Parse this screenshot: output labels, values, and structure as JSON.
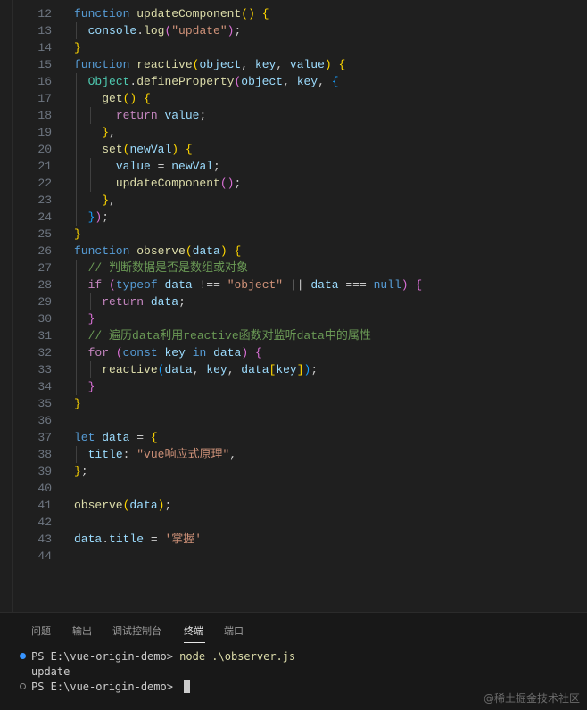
{
  "editor": {
    "lines": [
      {
        "num": "12",
        "tokens": [
          {
            "t": "function",
            "c": "k"
          },
          {
            "t": " "
          },
          {
            "t": "updateComponent",
            "c": "f"
          },
          {
            "t": "()",
            "c": "b1"
          },
          {
            "t": " "
          },
          {
            "t": "{",
            "c": "b1"
          }
        ]
      },
      {
        "num": "13",
        "tokens": [
          {
            "t": "  "
          },
          {
            "t": "console",
            "c": "v"
          },
          {
            "t": "."
          },
          {
            "t": "log",
            "c": "f"
          },
          {
            "t": "(",
            "c": "b2"
          },
          {
            "t": "\"update\"",
            "c": "s"
          },
          {
            "t": ")",
            "c": "b2"
          },
          {
            "t": ";"
          }
        ]
      },
      {
        "num": "14",
        "tokens": [
          {
            "t": "}",
            "c": "b1"
          }
        ]
      },
      {
        "num": "15",
        "tokens": [
          {
            "t": "function",
            "c": "k"
          },
          {
            "t": " "
          },
          {
            "t": "reactive",
            "c": "f"
          },
          {
            "t": "(",
            "c": "b1"
          },
          {
            "t": "object",
            "c": "v"
          },
          {
            "t": ", "
          },
          {
            "t": "key",
            "c": "v"
          },
          {
            "t": ", "
          },
          {
            "t": "value",
            "c": "v"
          },
          {
            "t": ")",
            "c": "b1"
          },
          {
            "t": " "
          },
          {
            "t": "{",
            "c": "b1"
          }
        ]
      },
      {
        "num": "16",
        "tokens": [
          {
            "t": "  "
          },
          {
            "t": "Object",
            "c": "t"
          },
          {
            "t": "."
          },
          {
            "t": "defineProperty",
            "c": "f"
          },
          {
            "t": "(",
            "c": "b2"
          },
          {
            "t": "object",
            "c": "v"
          },
          {
            "t": ", "
          },
          {
            "t": "key",
            "c": "v"
          },
          {
            "t": ", "
          },
          {
            "t": "{",
            "c": "b3"
          }
        ]
      },
      {
        "num": "17",
        "tokens": [
          {
            "t": "    "
          },
          {
            "t": "get",
            "c": "f"
          },
          {
            "t": "()",
            "c": "b1"
          },
          {
            "t": " "
          },
          {
            "t": "{",
            "c": "b1"
          }
        ]
      },
      {
        "num": "18",
        "tokens": [
          {
            "t": "      "
          },
          {
            "t": "return",
            "c": "c"
          },
          {
            "t": " "
          },
          {
            "t": "value",
            "c": "v"
          },
          {
            "t": ";"
          }
        ]
      },
      {
        "num": "19",
        "tokens": [
          {
            "t": "    "
          },
          {
            "t": "}",
            "c": "b1"
          },
          {
            "t": ","
          }
        ]
      },
      {
        "num": "20",
        "tokens": [
          {
            "t": "    "
          },
          {
            "t": "set",
            "c": "f"
          },
          {
            "t": "(",
            "c": "b1"
          },
          {
            "t": "newVal",
            "c": "v"
          },
          {
            "t": ")",
            "c": "b1"
          },
          {
            "t": " "
          },
          {
            "t": "{",
            "c": "b1"
          }
        ]
      },
      {
        "num": "21",
        "tokens": [
          {
            "t": "      "
          },
          {
            "t": "value",
            "c": "v"
          },
          {
            "t": " = "
          },
          {
            "t": "newVal",
            "c": "v"
          },
          {
            "t": ";"
          }
        ]
      },
      {
        "num": "22",
        "tokens": [
          {
            "t": "      "
          },
          {
            "t": "updateComponent",
            "c": "f"
          },
          {
            "t": "()",
            "c": "b2"
          },
          {
            "t": ";"
          }
        ]
      },
      {
        "num": "23",
        "tokens": [
          {
            "t": "    "
          },
          {
            "t": "}",
            "c": "b1"
          },
          {
            "t": ","
          }
        ]
      },
      {
        "num": "24",
        "tokens": [
          {
            "t": "  "
          },
          {
            "t": "}",
            "c": "b3"
          },
          {
            "t": ")",
            "c": "b2"
          },
          {
            "t": ";"
          }
        ]
      },
      {
        "num": "25",
        "tokens": [
          {
            "t": "}",
            "c": "b1"
          }
        ]
      },
      {
        "num": "26",
        "tokens": [
          {
            "t": "function",
            "c": "k"
          },
          {
            "t": " "
          },
          {
            "t": "observe",
            "c": "f"
          },
          {
            "t": "(",
            "c": "b1"
          },
          {
            "t": "data",
            "c": "v"
          },
          {
            "t": ")",
            "c": "b1"
          },
          {
            "t": " "
          },
          {
            "t": "{",
            "c": "b1"
          }
        ]
      },
      {
        "num": "27",
        "tokens": [
          {
            "t": "  "
          },
          {
            "t": "// 判断数据是否是数组或对象",
            "c": "cm"
          }
        ]
      },
      {
        "num": "28",
        "tokens": [
          {
            "t": "  "
          },
          {
            "t": "if",
            "c": "c"
          },
          {
            "t": " "
          },
          {
            "t": "(",
            "c": "b2"
          },
          {
            "t": "typeof",
            "c": "k"
          },
          {
            "t": " "
          },
          {
            "t": "data",
            "c": "v"
          },
          {
            "t": " !== "
          },
          {
            "t": "\"object\"",
            "c": "s"
          },
          {
            "t": " || "
          },
          {
            "t": "data",
            "c": "v"
          },
          {
            "t": " === "
          },
          {
            "t": "null",
            "c": "k"
          },
          {
            "t": ")",
            "c": "b2"
          },
          {
            "t": " "
          },
          {
            "t": "{",
            "c": "b2"
          }
        ]
      },
      {
        "num": "29",
        "tokens": [
          {
            "t": "    "
          },
          {
            "t": "return",
            "c": "c"
          },
          {
            "t": " "
          },
          {
            "t": "data",
            "c": "v"
          },
          {
            "t": ";"
          }
        ]
      },
      {
        "num": "30",
        "tokens": [
          {
            "t": "  "
          },
          {
            "t": "}",
            "c": "b2"
          }
        ]
      },
      {
        "num": "31",
        "tokens": [
          {
            "t": "  "
          },
          {
            "t": "// 遍历data利用reactive函数对监听data中的属性",
            "c": "cm"
          }
        ]
      },
      {
        "num": "32",
        "tokens": [
          {
            "t": "  "
          },
          {
            "t": "for",
            "c": "c"
          },
          {
            "t": " "
          },
          {
            "t": "(",
            "c": "b2"
          },
          {
            "t": "const",
            "c": "k"
          },
          {
            "t": " "
          },
          {
            "t": "key",
            "c": "v"
          },
          {
            "t": " "
          },
          {
            "t": "in",
            "c": "k"
          },
          {
            "t": " "
          },
          {
            "t": "data",
            "c": "v"
          },
          {
            "t": ")",
            "c": "b2"
          },
          {
            "t": " "
          },
          {
            "t": "{",
            "c": "b2"
          }
        ]
      },
      {
        "num": "33",
        "tokens": [
          {
            "t": "    "
          },
          {
            "t": "reactive",
            "c": "f"
          },
          {
            "t": "(",
            "c": "b3"
          },
          {
            "t": "data",
            "c": "v"
          },
          {
            "t": ", "
          },
          {
            "t": "key",
            "c": "v"
          },
          {
            "t": ", "
          },
          {
            "t": "data",
            "c": "v"
          },
          {
            "t": "[",
            "c": "b1"
          },
          {
            "t": "key",
            "c": "v"
          },
          {
            "t": "]",
            "c": "b1"
          },
          {
            "t": ")",
            "c": "b3"
          },
          {
            "t": ";"
          }
        ]
      },
      {
        "num": "34",
        "tokens": [
          {
            "t": "  "
          },
          {
            "t": "}",
            "c": "b2"
          }
        ]
      },
      {
        "num": "35",
        "tokens": [
          {
            "t": "}",
            "c": "b1"
          }
        ]
      },
      {
        "num": "36",
        "tokens": []
      },
      {
        "num": "37",
        "tokens": [
          {
            "t": "let",
            "c": "k"
          },
          {
            "t": " "
          },
          {
            "t": "data",
            "c": "v"
          },
          {
            "t": " = "
          },
          {
            "t": "{",
            "c": "b1"
          }
        ]
      },
      {
        "num": "38",
        "tokens": [
          {
            "t": "  "
          },
          {
            "t": "title",
            "c": "v"
          },
          {
            "t": ": "
          },
          {
            "t": "\"vue响应式原理\"",
            "c": "s"
          },
          {
            "t": ","
          }
        ]
      },
      {
        "num": "39",
        "tokens": [
          {
            "t": "}",
            "c": "b1"
          },
          {
            "t": ";"
          }
        ]
      },
      {
        "num": "40",
        "tokens": []
      },
      {
        "num": "41",
        "tokens": [
          {
            "t": "observe",
            "c": "f"
          },
          {
            "t": "(",
            "c": "b1"
          },
          {
            "t": "data",
            "c": "v"
          },
          {
            "t": ")",
            "c": "b1"
          },
          {
            "t": ";"
          }
        ]
      },
      {
        "num": "42",
        "tokens": []
      },
      {
        "num": "43",
        "tokens": [
          {
            "t": "data",
            "c": "v"
          },
          {
            "t": "."
          },
          {
            "t": "title",
            "c": "v"
          },
          {
            "t": " = "
          },
          {
            "t": "'掌握'",
            "c": "s"
          }
        ]
      },
      {
        "num": "44",
        "tokens": []
      }
    ]
  },
  "panel": {
    "tabs": [
      {
        "label": "问题",
        "active": false
      },
      {
        "label": "输出",
        "active": false
      },
      {
        "label": "调试控制台",
        "active": false
      },
      {
        "label": "终端",
        "active": true
      },
      {
        "label": "端口",
        "active": false
      }
    ]
  },
  "terminal": {
    "lines": [
      {
        "prompt": "PS E:\\vue-origin-demo> ",
        "command": "node .\\observer.js",
        "dot": "filled"
      },
      {
        "prompt": "update",
        "command": "",
        "dot": "none"
      },
      {
        "prompt": "PS E:\\vue-origin-demo> ",
        "command": "",
        "dot": "hollow",
        "cursor": true
      }
    ],
    "dot_color": "#3794ff",
    "dot_hollow_color": "#8a8a8a"
  },
  "watermark": "@稀土掘金技术社区"
}
